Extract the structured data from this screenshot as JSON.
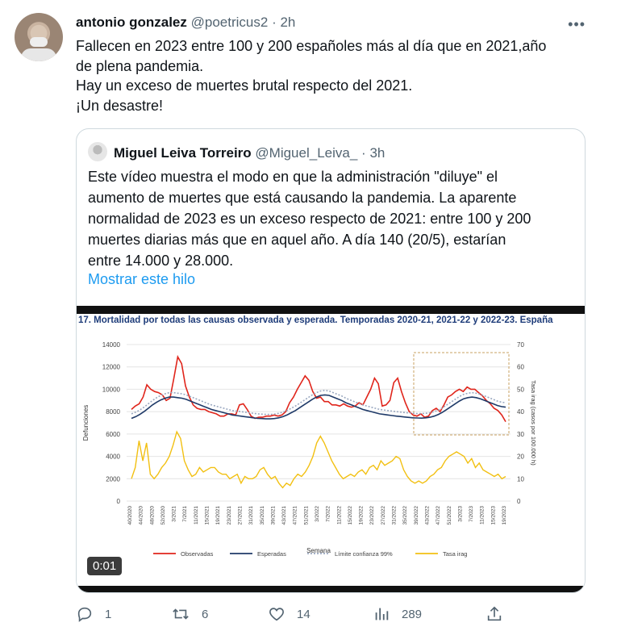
{
  "tweet": {
    "author_name": "antonio gonzalez",
    "author_handle": "@poetricus2",
    "separator": "·",
    "time": "2h",
    "more_icon": "more-horizontal-icon",
    "text_lines": [
      "Fallecen en 2023 entre 100 y 200 españoles más al día que en 2021,año",
      "de plena pandemia.",
      "Hay un exceso de muertes brutal respecto del 2021.",
      "¡Un desastre!"
    ]
  },
  "quote": {
    "author_name": "Miguel Leiva Torreiro",
    "author_handle": "@Miguel_Leiva_",
    "separator": "·",
    "time": "3h",
    "text_lines": [
      "Este vídeo muestra el modo en que la administración \"diluye\" el",
      "aumento de muertes que está causando la pandemia. La aparente",
      "normalidad de 2023 es un exceso respecto de 2021: entre 100 y 200",
      "muertes diarias más que en aquel año. A día 140 (20/5), estarían",
      "entre 14.000 y 28.000."
    ],
    "show_thread": "Mostrar este hilo",
    "video_time": "0:01"
  },
  "chart_data": {
    "type": "line",
    "title": "17. Mortalidad por todas las causas observada y esperada. Temporadas 2020-21, 2021-22 y 2022-23. España",
    "xlabel": "Semana",
    "ylabel": "Defunciones",
    "ylabel_right": "Tasa irag (casos por 100.000 h)",
    "ylim": [
      0,
      14000
    ],
    "ylim_right": [
      0,
      70
    ],
    "yticks": [
      "14000",
      "12000",
      "10000",
      "8000",
      "6000",
      "4000",
      "2000",
      "0"
    ],
    "yticks_right": [
      "70",
      "60",
      "50",
      "40",
      "30",
      "20",
      "10",
      "0"
    ],
    "x_ticks": [
      "40/2020",
      "44/2020",
      "48/2020",
      "52/2020",
      "3/2021",
      "7/2021",
      "11/2021",
      "15/2021",
      "19/2021",
      "23/2021",
      "27/2021",
      "31/2021",
      "35/2021",
      "39/2021",
      "43/2021",
      "47/2021",
      "51/2021",
      "3/2022",
      "7/2022",
      "11/2022",
      "15/2022",
      "19/2022",
      "23/2022",
      "27/2022",
      "31/2022",
      "35/2022",
      "39/2022",
      "43/2022",
      "47/2022",
      "51/2022",
      "3/2023",
      "7/2023",
      "11/2023",
      "15/2023",
      "19/2023"
    ],
    "series": [
      {
        "name": "Observadas",
        "color": "#e0251b",
        "axis": "left",
        "values": [
          8200,
          8500,
          8700,
          9300,
          10400,
          10000,
          9800,
          9700,
          9500,
          9000,
          9200,
          11000,
          12900,
          12300,
          10300,
          9300,
          8600,
          8300,
          8200,
          8200,
          8000,
          7900,
          7800,
          7600,
          7600,
          7800,
          7800,
          7700,
          8600,
          8700,
          8200,
          7600,
          7400,
          7500,
          7500,
          7600,
          7600,
          7700,
          7600,
          7700,
          8000,
          8800,
          9300,
          10000,
          10600,
          11200,
          10800,
          9800,
          9200,
          9300,
          8900,
          8900,
          8600,
          8600,
          8500,
          8700,
          8500,
          8400,
          8500,
          8800,
          8600,
          9300,
          10000,
          11000,
          10500,
          8500,
          8600,
          9000,
          10600,
          11000,
          9800,
          8800,
          8000,
          7700,
          7600,
          7800,
          7500,
          7600,
          8100,
          8300,
          8000,
          8600,
          9300,
          9500,
          9800,
          10000,
          9800,
          10200,
          10000,
          10000,
          9700,
          9400,
          9000,
          8700,
          8300,
          8100,
          7700,
          7100
        ],
        "ci_note": "none"
      },
      {
        "name": "Esperadas",
        "color": "#1f3a68",
        "axis": "left",
        "values": [
          7400,
          7550,
          7750,
          8000,
          8300,
          8600,
          8850,
          9050,
          9200,
          9300,
          9300,
          9250,
          9200,
          9100,
          8950,
          8800,
          8650,
          8500,
          8350,
          8200,
          8100,
          8000,
          7900,
          7800,
          7700,
          7650,
          7600,
          7550,
          7500,
          7450,
          7400,
          7380,
          7350,
          7350,
          7380,
          7450,
          7550,
          7700,
          7900,
          8100,
          8350,
          8600,
          8850,
          9100,
          9300,
          9450,
          9500,
          9450,
          9300,
          9150,
          9000,
          8800,
          8650,
          8500,
          8350,
          8200,
          8100,
          8000,
          7900,
          7800,
          7750,
          7700,
          7650,
          7600,
          7560,
          7520,
          7480,
          7450,
          7430,
          7420,
          7450,
          7500,
          7600,
          7750,
          7950,
          8200,
          8450,
          8700,
          8950,
          9150,
          9250,
          9300,
          9250,
          9150,
          9000,
          8850,
          8700,
          8550,
          8450,
          8400
        ]
      },
      {
        "name": "Límite confianza 99%",
        "color": "#9aa8c0",
        "axis": "left",
        "values": [
          7800,
          7950,
          8150,
          8400,
          8700,
          9000,
          9250,
          9450,
          9600,
          9700,
          9700,
          9650,
          9600,
          9500,
          9350,
          9200,
          9050,
          8900,
          8750,
          8600,
          8500,
          8400,
          8300,
          8200,
          8100,
          8050,
          8000,
          7950,
          7900,
          7850,
          7800,
          7780,
          7750,
          7750,
          7780,
          7850,
          7950,
          8100,
          8300,
          8500,
          8750,
          9000,
          9250,
          9500,
          9700,
          9850,
          9900,
          9850,
          9700,
          9550,
          9400,
          9200,
          9050,
          8900,
          8750,
          8600,
          8500,
          8400,
          8300,
          8200,
          8150,
          8100,
          8050,
          8000,
          7960,
          7920,
          7880,
          7850,
          7830,
          7820,
          7850,
          7900,
          8000,
          8150,
          8350,
          8600,
          8850,
          9100,
          9350,
          9550,
          9650,
          9700,
          9650,
          9550,
          9400,
          9250,
          9100,
          8950,
          8850,
          8800
        ]
      },
      {
        "name": "Tasa irag",
        "color": "#f2c012",
        "axis": "right",
        "values": [
          10,
          15,
          27,
          18,
          26,
          12,
          10,
          12,
          15,
          17,
          20,
          25,
          31,
          28,
          18,
          14,
          11,
          12,
          15,
          13,
          14,
          15,
          15,
          13,
          12,
          12,
          10,
          11,
          12,
          8,
          11,
          10,
          10,
          11,
          14,
          15,
          12,
          10,
          11,
          8,
          6,
          8,
          7,
          10,
          12,
          11,
          13,
          16,
          20,
          26,
          29,
          26,
          22,
          18,
          15,
          12,
          10,
          11,
          12,
          11,
          13,
          14,
          12,
          15,
          16,
          14,
          18,
          16,
          17,
          18,
          20,
          19,
          14,
          11,
          9,
          8,
          9,
          8,
          9,
          11,
          12,
          14,
          15,
          18,
          20,
          21,
          22,
          21,
          20,
          17,
          19,
          15,
          17,
          14,
          13,
          12,
          11,
          12,
          10,
          11
        ],
        "note": ""
      }
    ],
    "legend": [
      "Observadas",
      "Esperadas",
      "Límite confianza 99%",
      "Tasa irag"
    ],
    "legend_position": "bottom",
    "highlight_box": "dashed box around the 2022-23 season peak"
  },
  "actions": {
    "reply": {
      "icon": "reply-icon",
      "count": "1"
    },
    "retweet": {
      "icon": "retweet-icon",
      "count": "6"
    },
    "like": {
      "icon": "heart-icon",
      "count": "14"
    },
    "views": {
      "icon": "views-chart-icon",
      "count": "289"
    },
    "share": {
      "icon": "share-icon"
    }
  }
}
